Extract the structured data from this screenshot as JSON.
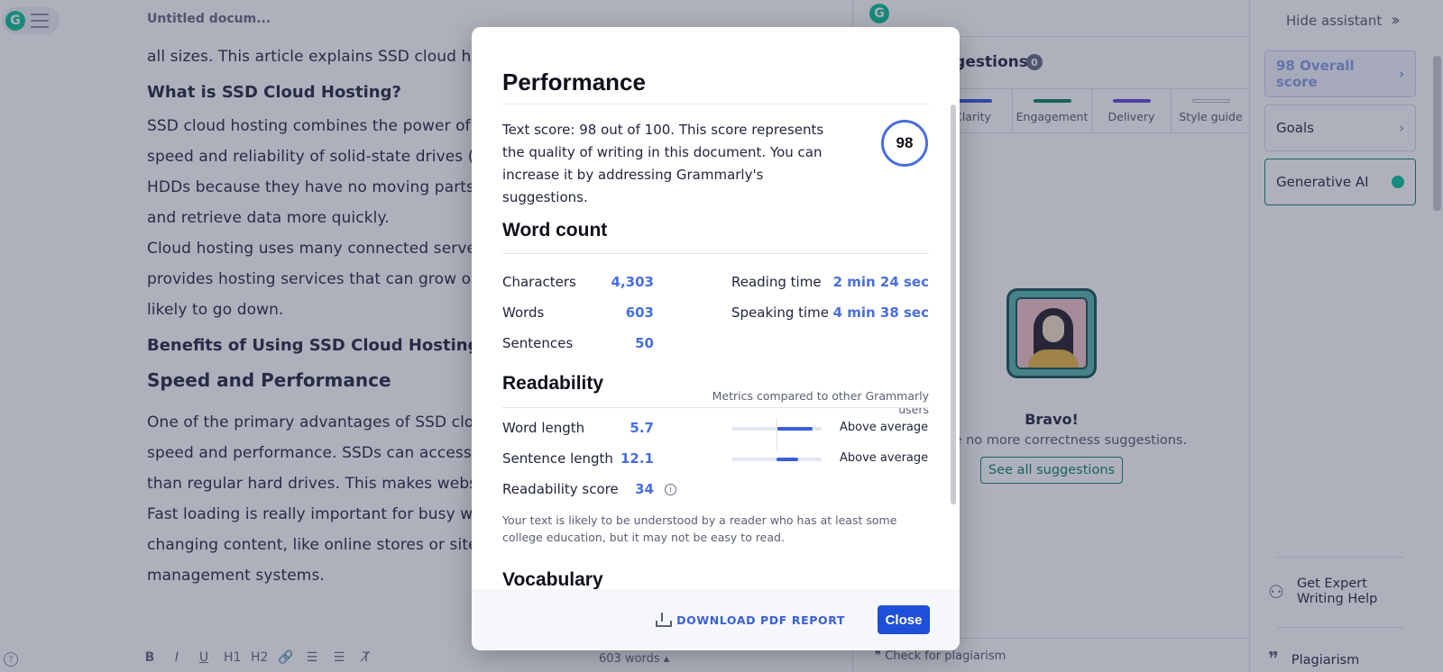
{
  "editor": {
    "doc_title": "Untitled docum...",
    "paragraphs": {
      "p0": "all sizes. This article explains SSD cloud ho",
      "h_what": "What is SSD Cloud Hosting?",
      "p1_l1": "SSD cloud hosting combines the power of",
      "p1_l2": "speed and reliability of solid-state drives (S",
      "p1_l3": "HDDs because they have no moving parts.",
      "p1_l4": "and retrieve data more quickly.",
      "p2_l1": "Cloud hosting uses many connected serve",
      "p2_l2": "provides hosting services that can grow or",
      "p2_l3": "likely to go down.",
      "h_benefits": "Benefits of Using SSD Cloud Hosting",
      "h_speed": "Speed and Performance",
      "p3_l1": "One of the primary advantages of SSD clou",
      "p3_l2": "speed and performance. SSDs can access",
      "p3_l3": "than regular hard drives. This makes webs",
      "p3_l4": "Fast loading is really important for busy we",
      "p3_l5": "changing content, like online stores or site",
      "p3_l6": "management systems."
    },
    "toolbar": [
      "B",
      "I",
      "U",
      "H1",
      "H2",
      "🔗",
      "☰",
      "☰",
      "T̸"
    ],
    "word_count": "603 words ▴"
  },
  "assistant": {
    "suggestions_title": "ggestions",
    "suggestions_count": "0",
    "tabs": [
      {
        "label": "Clarity",
        "color": "#3a60d8"
      },
      {
        "label": "Engagement",
        "color": "#15876a"
      },
      {
        "label": "Delivery",
        "color": "#6d4fd6"
      },
      {
        "label": "Style guide",
        "color": "#d4d7e0"
      }
    ],
    "bravo": "Bravo!",
    "bravo_sub": "re no more correctness suggestions.",
    "see_all": "See all suggestions",
    "plagiarism_check": "❞ Check for plagiarism"
  },
  "sidebar": {
    "hide_assistant": "Hide assistant",
    "overall_score": "98 Overall score",
    "goals": "Goals",
    "generative_ai": "Generative AI",
    "expert_help_1": "Get Expert",
    "expert_help_2": "Writing Help",
    "plagiarism": "Plagiarism"
  },
  "modal": {
    "performance_title": "Performance",
    "performance_text": "Text score: 98 out of 100. This score represents the quality of writing in this document. You can increase it by addressing Grammarly's suggestions.",
    "score": "98",
    "word_count_title": "Word count",
    "characters_label": "Characters",
    "characters": "4,303",
    "words_label": "Words",
    "words": "603",
    "sentences_label": "Sentences",
    "sentences": "50",
    "reading_time_label": "Reading time",
    "reading_time": "2 min 24 sec",
    "speaking_time_label": "Speaking time",
    "speaking_time": "4 min 38 sec",
    "readability_title": "Readability",
    "readability_note": "Metrics compared to other Grammarly users",
    "word_length_label": "Word length",
    "word_length": "5.7",
    "word_length_level": "Above average",
    "sentence_length_label": "Sentence length",
    "sentence_length": "12.1",
    "sentence_length_level": "Above average",
    "readability_score_label": "Readability score",
    "readability_score": "34",
    "readability_explain": "Your text is likely to be understood by a reader who has at least some college education, but it may not be easy to read.",
    "cut_section": "Vocabulary",
    "download": "DOWNLOAD PDF REPORT",
    "close": "Close"
  },
  "colors": {
    "accent_blue": "#3a60d8",
    "grammarly_green": "#15c39a",
    "close_button": "#1e4fd8"
  },
  "icons": [
    "grammarly-logo-icon",
    "menu-icon",
    "help-icon",
    "chevron-right-icon",
    "double-chevron-right-icon",
    "bulb-icon",
    "info-icon",
    "download-icon",
    "expert-person-icon",
    "quote-icon"
  ]
}
